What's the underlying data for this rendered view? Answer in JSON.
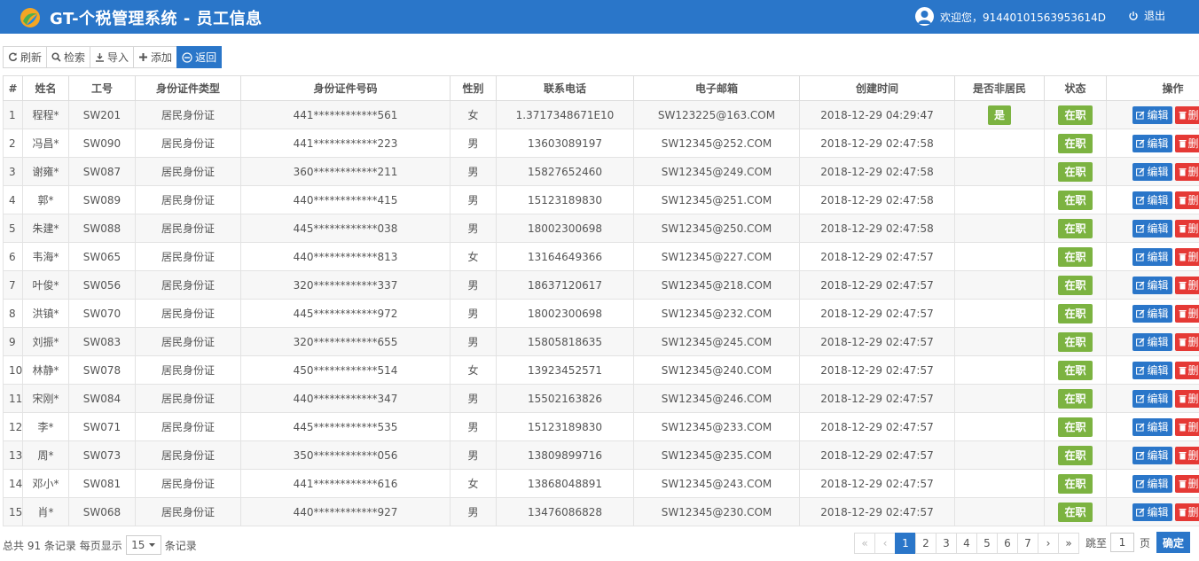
{
  "header": {
    "title": "GT-个税管理系统 - 员工信息",
    "welcome": "欢迎您，91440101563953614D",
    "logout": "退出"
  },
  "toolbar": {
    "refresh": "刷新",
    "search": "检索",
    "import": "导入",
    "add": "添加",
    "back": "返回"
  },
  "table": {
    "headers": [
      "#",
      "姓名",
      "工号",
      "身份证件类型",
      "身份证件号码",
      "性别",
      "联系电话",
      "电子邮箱",
      "创建时间",
      "是否非居民",
      "状态",
      "操作"
    ],
    "edit_label": "编辑",
    "delete_label": "删除",
    "rows": [
      {
        "idx": "1",
        "name": "程程*",
        "no": "SW201",
        "idtype": "居民身份证",
        "idnum": "441************561",
        "sex": "女",
        "phone": "1.3717348671E10",
        "email": "SW123225@163.COM",
        "created": "2018-12-29 04:29:47",
        "nonres": "是",
        "status": "在职"
      },
      {
        "idx": "2",
        "name": "冯昌*",
        "no": "SW090",
        "idtype": "居民身份证",
        "idnum": "441************223",
        "sex": "男",
        "phone": "13603089197",
        "email": "SW12345@252.COM",
        "created": "2018-12-29 02:47:58",
        "nonres": "",
        "status": "在职"
      },
      {
        "idx": "3",
        "name": "谢雍*",
        "no": "SW087",
        "idtype": "居民身份证",
        "idnum": "360************211",
        "sex": "男",
        "phone": "15827652460",
        "email": "SW12345@249.COM",
        "created": "2018-12-29 02:47:58",
        "nonres": "",
        "status": "在职"
      },
      {
        "idx": "4",
        "name": "郭*",
        "no": "SW089",
        "idtype": "居民身份证",
        "idnum": "440************415",
        "sex": "男",
        "phone": "15123189830",
        "email": "SW12345@251.COM",
        "created": "2018-12-29 02:47:58",
        "nonres": "",
        "status": "在职"
      },
      {
        "idx": "5",
        "name": "朱建*",
        "no": "SW088",
        "idtype": "居民身份证",
        "idnum": "445************038",
        "sex": "男",
        "phone": "18002300698",
        "email": "SW12345@250.COM",
        "created": "2018-12-29 02:47:58",
        "nonres": "",
        "status": "在职"
      },
      {
        "idx": "6",
        "name": "韦海*",
        "no": "SW065",
        "idtype": "居民身份证",
        "idnum": "440************813",
        "sex": "女",
        "phone": "13164649366",
        "email": "SW12345@227.COM",
        "created": "2018-12-29 02:47:57",
        "nonres": "",
        "status": "在职"
      },
      {
        "idx": "7",
        "name": "叶俊*",
        "no": "SW056",
        "idtype": "居民身份证",
        "idnum": "320************337",
        "sex": "男",
        "phone": "18637120617",
        "email": "SW12345@218.COM",
        "created": "2018-12-29 02:47:57",
        "nonres": "",
        "status": "在职"
      },
      {
        "idx": "8",
        "name": "洪镇*",
        "no": "SW070",
        "idtype": "居民身份证",
        "idnum": "445************972",
        "sex": "男",
        "phone": "18002300698",
        "email": "SW12345@232.COM",
        "created": "2018-12-29 02:47:57",
        "nonres": "",
        "status": "在职"
      },
      {
        "idx": "9",
        "name": "刘振*",
        "no": "SW083",
        "idtype": "居民身份证",
        "idnum": "320************655",
        "sex": "男",
        "phone": "15805818635",
        "email": "SW12345@245.COM",
        "created": "2018-12-29 02:47:57",
        "nonres": "",
        "status": "在职"
      },
      {
        "idx": "10",
        "name": "林静*",
        "no": "SW078",
        "idtype": "居民身份证",
        "idnum": "450************514",
        "sex": "女",
        "phone": "13923452571",
        "email": "SW12345@240.COM",
        "created": "2018-12-29 02:47:57",
        "nonres": "",
        "status": "在职"
      },
      {
        "idx": "11",
        "name": "宋刚*",
        "no": "SW084",
        "idtype": "居民身份证",
        "idnum": "440************347",
        "sex": "男",
        "phone": "15502163826",
        "email": "SW12345@246.COM",
        "created": "2018-12-29 02:47:57",
        "nonres": "",
        "status": "在职"
      },
      {
        "idx": "12",
        "name": "李*",
        "no": "SW071",
        "idtype": "居民身份证",
        "idnum": "445************535",
        "sex": "男",
        "phone": "15123189830",
        "email": "SW12345@233.COM",
        "created": "2018-12-29 02:47:57",
        "nonres": "",
        "status": "在职"
      },
      {
        "idx": "13",
        "name": "周*",
        "no": "SW073",
        "idtype": "居民身份证",
        "idnum": "350************056",
        "sex": "男",
        "phone": "13809899716",
        "email": "SW12345@235.COM",
        "created": "2018-12-29 02:47:57",
        "nonres": "",
        "status": "在职"
      },
      {
        "idx": "14",
        "name": "邓小*",
        "no": "SW081",
        "idtype": "居民身份证",
        "idnum": "441************616",
        "sex": "女",
        "phone": "13868048891",
        "email": "SW12345@243.COM",
        "created": "2018-12-29 02:47:57",
        "nonres": "",
        "status": "在职"
      },
      {
        "idx": "15",
        "name": "肖*",
        "no": "SW068",
        "idtype": "居民身份证",
        "idnum": "440************927",
        "sex": "男",
        "phone": "13476086828",
        "email": "SW12345@230.COM",
        "created": "2018-12-29 02:47:57",
        "nonres": "",
        "status": "在职"
      }
    ]
  },
  "footer": {
    "total_text": "总共 91 条记录 每页显示",
    "page_size": "15",
    "records_label": "条记录",
    "pages": [
      "«",
      "‹",
      "1",
      "2",
      "3",
      "4",
      "5",
      "6",
      "7",
      "›",
      "»"
    ],
    "current_page": "1",
    "jump_label": "跳至",
    "jump_value": "1",
    "jump_unit": "页",
    "confirm": "确定"
  },
  "colors": {
    "primary": "#2a76c9",
    "success": "#7cb341",
    "danger": "#e53935"
  }
}
